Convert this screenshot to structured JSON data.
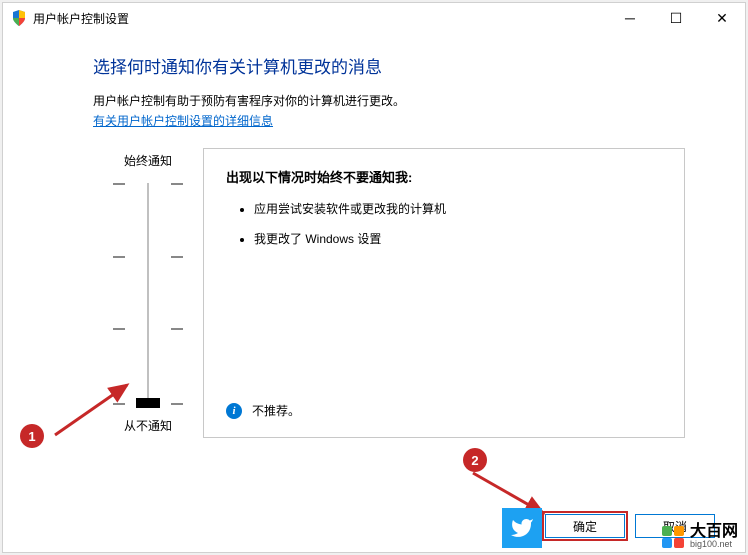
{
  "titlebar": {
    "title": "用户帐户控制设置"
  },
  "heading": "选择何时通知你有关计算机更改的消息",
  "desc": "用户帐户控制有助于预防有害程序对你的计算机进行更改。",
  "link": "有关用户帐户控制设置的详细信息",
  "slider": {
    "topLabel": "始终通知",
    "bottomLabel": "从不通知",
    "position": 3,
    "levels": 4
  },
  "infoBox": {
    "title": "出现以下情况时始终不要通知我:",
    "items": [
      "应用尝试安装软件或更改我的计算机",
      "我更改了 Windows 设置"
    ],
    "footerText": "不推荐。"
  },
  "buttons": {
    "ok": "确定",
    "cancel": "取消"
  },
  "annotations": {
    "callout1": "1",
    "callout2": "2"
  },
  "watermark": {
    "main": "大百网",
    "sub": "big100.net"
  }
}
